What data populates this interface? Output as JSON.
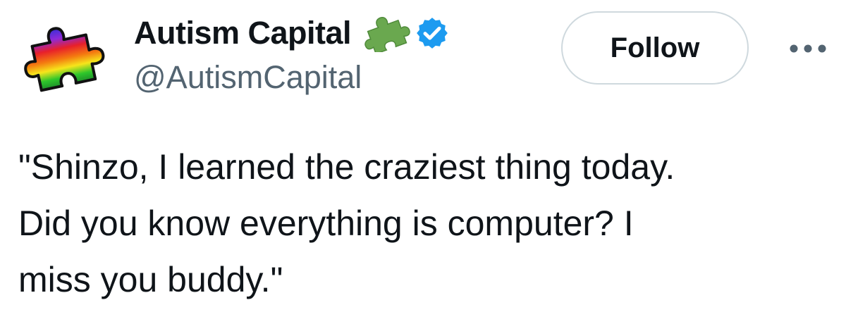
{
  "tweet": {
    "author": {
      "display_name": "Autism Capital",
      "handle": "@AutismCapital",
      "avatar_icon": "rainbow-puzzle-piece-icon",
      "badges": [
        "puzzle-piece-icon",
        "verified-badge-icon"
      ]
    },
    "follow_label": "Follow",
    "more_icon": "more-options-icon",
    "text": "\"Shinzo, I learned the craziest thing today.\nDid you know everything is computer? I\nmiss you buddy.\""
  },
  "colors": {
    "name_text": "#0f1419",
    "handle_text": "#536471",
    "verified_blue": "#1d9bf0",
    "puzzle_green": "#6aa84f",
    "follow_border": "#cfd9de"
  }
}
